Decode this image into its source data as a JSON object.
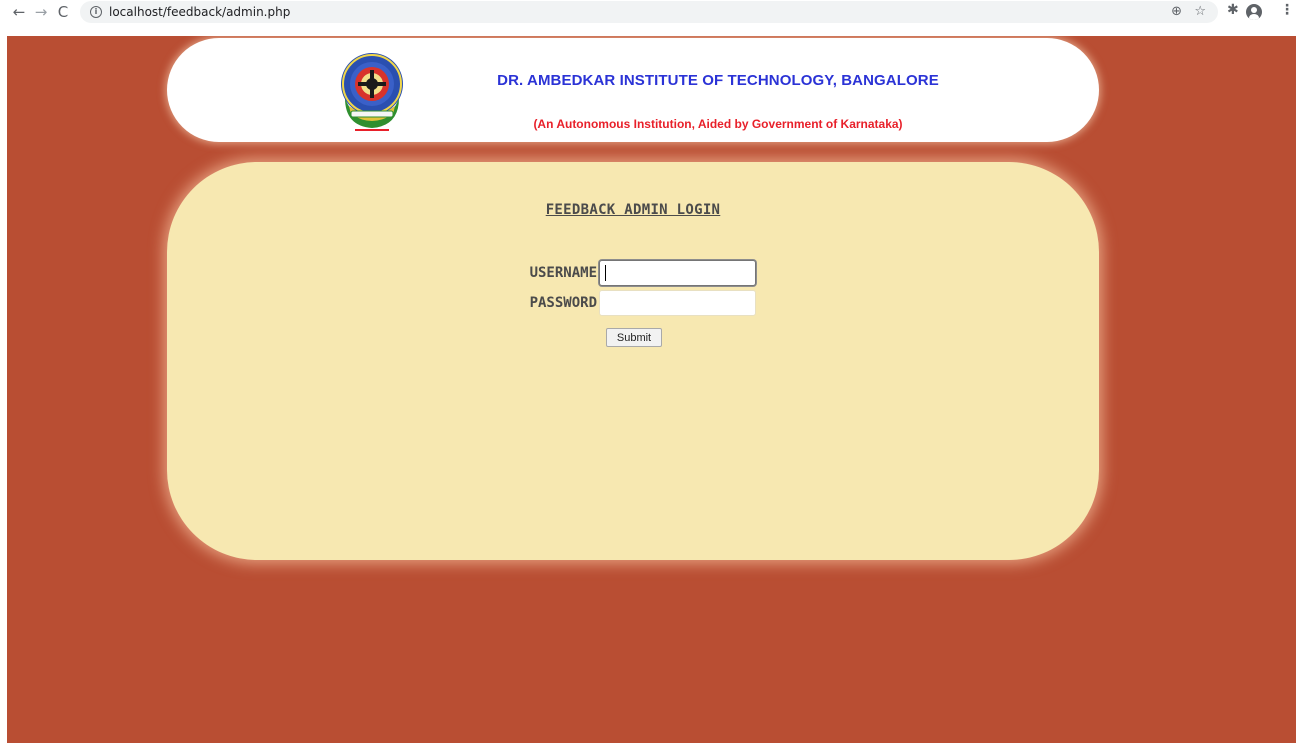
{
  "browser": {
    "back_icon": "←",
    "forward_icon": "→",
    "reload_icon": "C",
    "info_icon": "i",
    "url": "localhost/feedback/admin.php",
    "zoom_icon": "⊕",
    "star_icon": "☆",
    "extensions_icon": "✱",
    "menu_icon": "⋮"
  },
  "header": {
    "institution_name": "DR. AMBEDKAR INSTITUTE OF TECHNOLOGY, BANGALORE",
    "subtitle": "(An Autonomous Institution, Aided by Government of Karnataka)"
  },
  "login": {
    "title": "FEEDBACK ADMIN LOGIN",
    "username_label": "USERNAME",
    "username_value": "",
    "password_label": "PASSWORD",
    "password_value": "",
    "submit_label": "Submit"
  },
  "colors": {
    "page_background": "#b94e33",
    "header_card": "#ffffff",
    "login_card": "#f7e8b1",
    "institution_name": "#2b33d6",
    "subtitle": "#e8202a",
    "label_text": "#4b4b4b"
  }
}
